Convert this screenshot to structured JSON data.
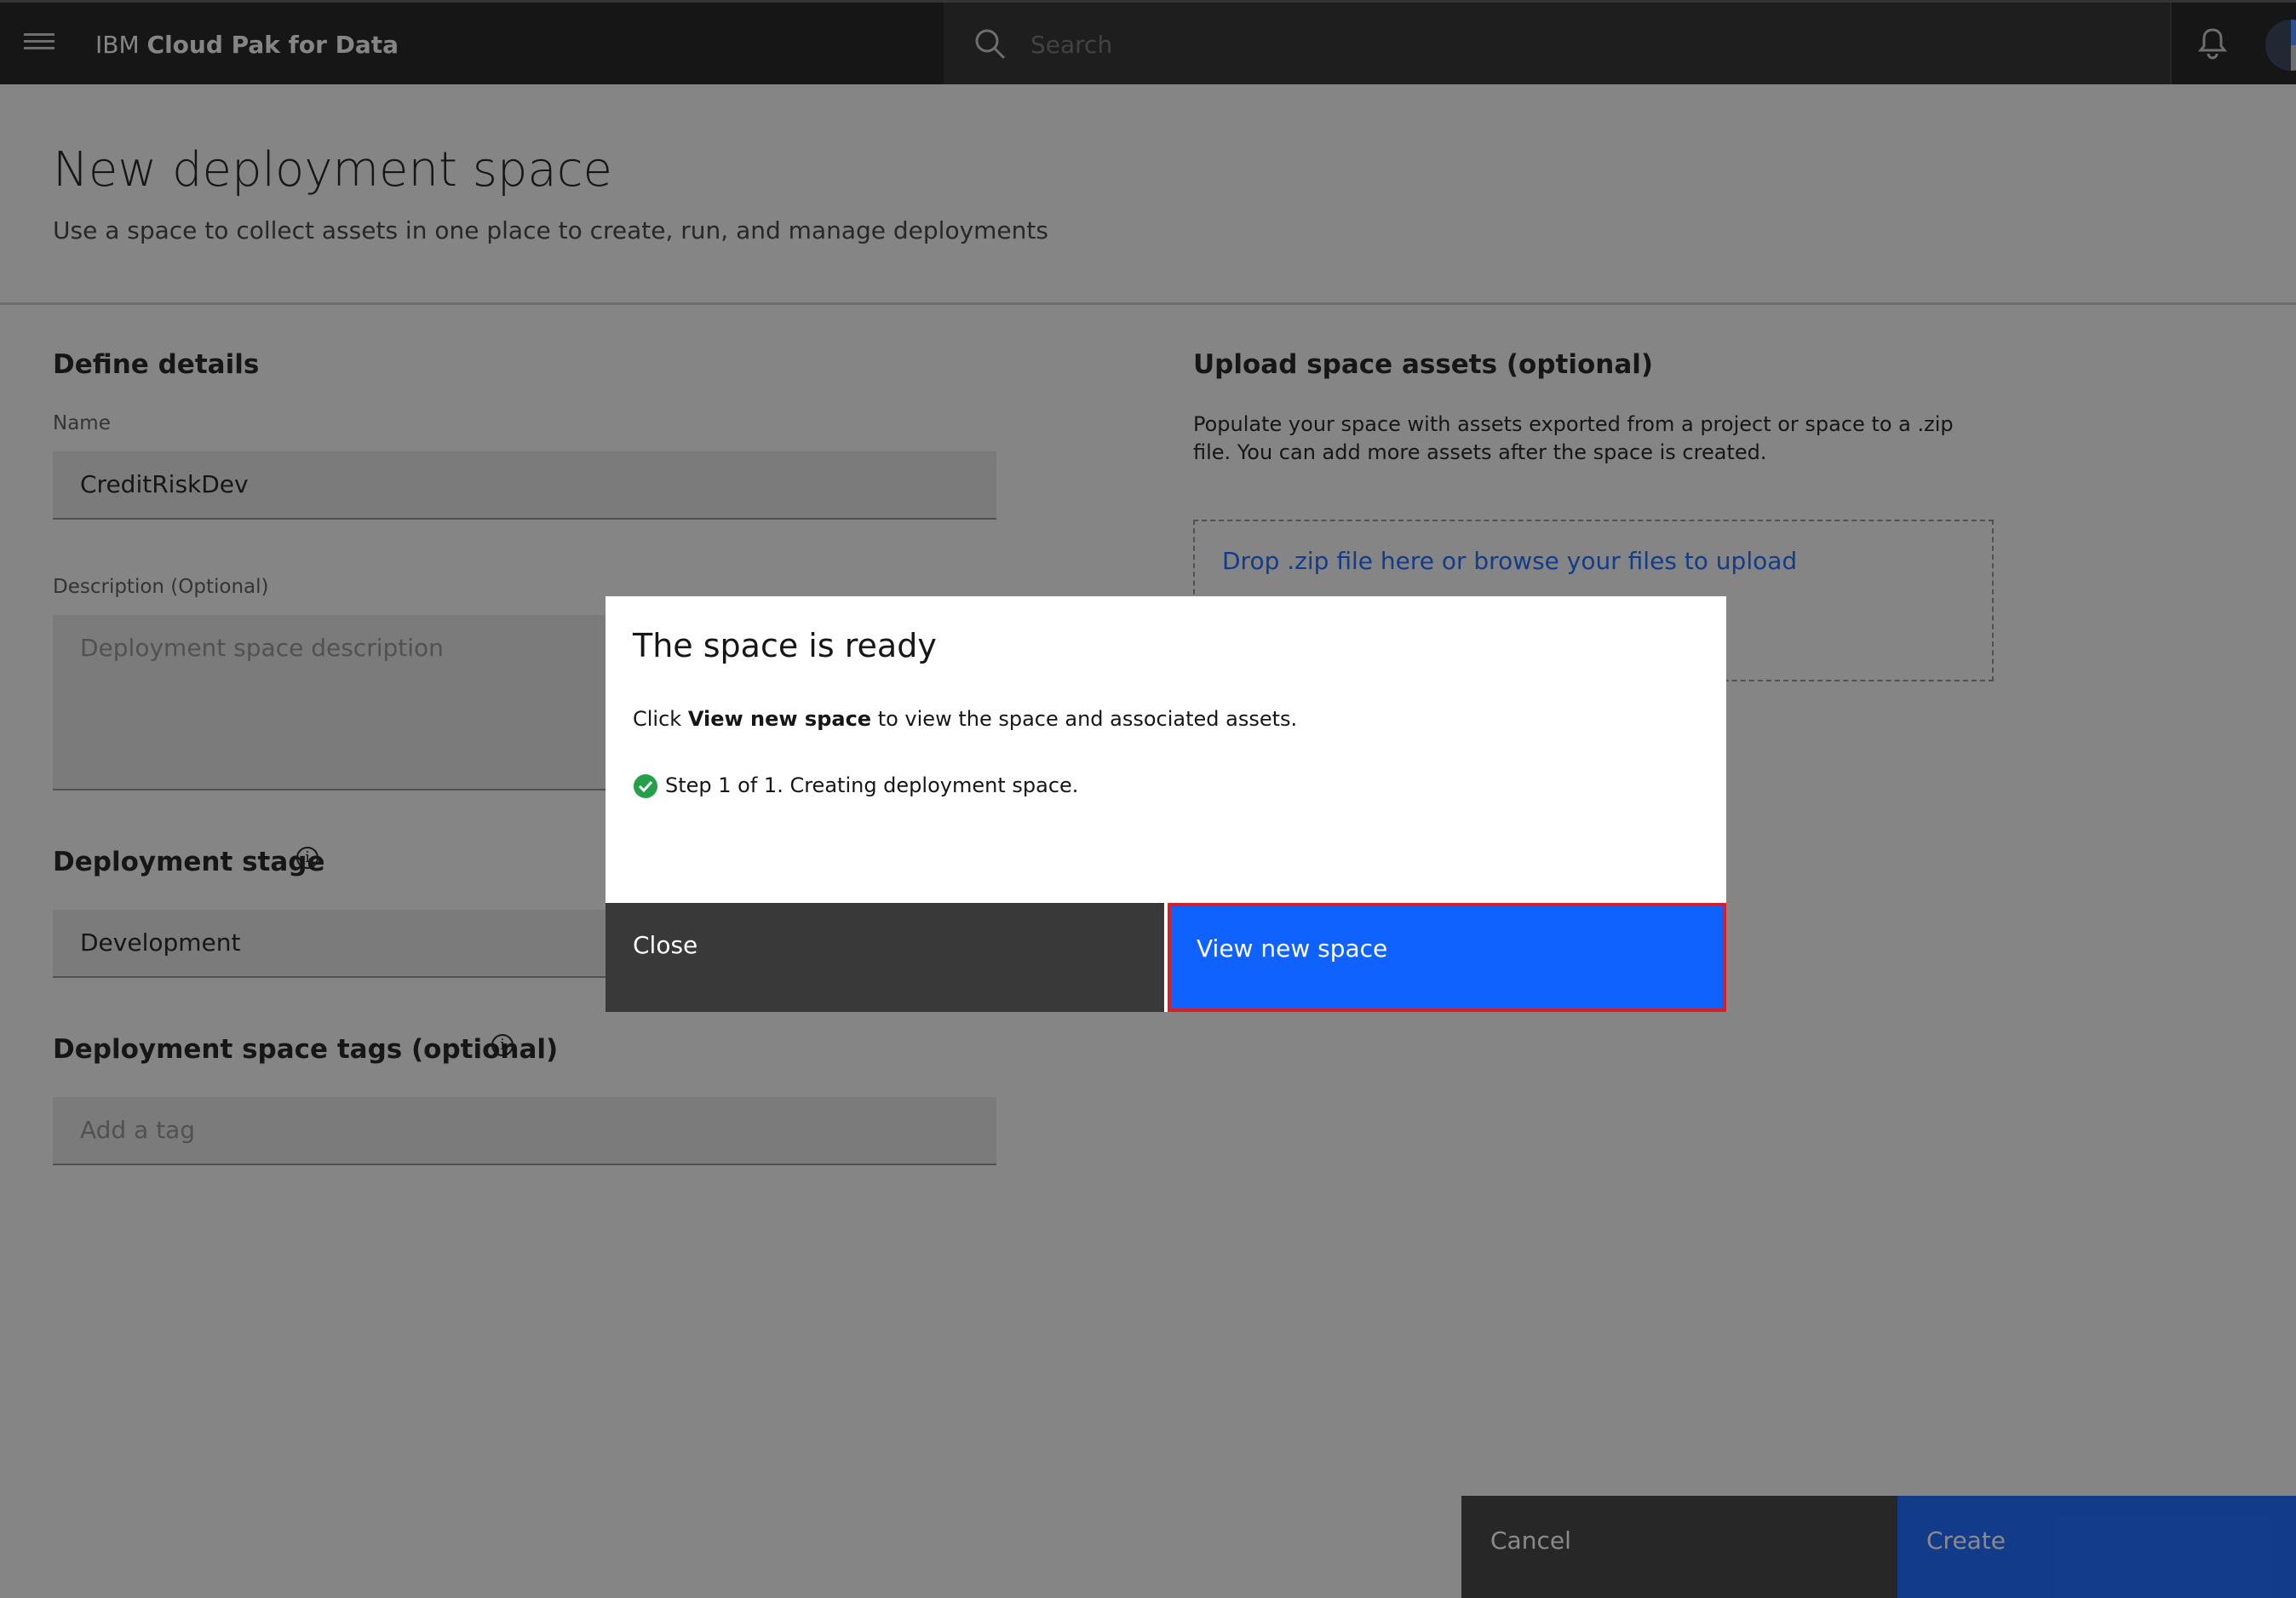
{
  "header": {
    "brand_prefix": "IBM",
    "brand_name": "Cloud Pak for Data",
    "search_placeholder": "Search"
  },
  "page": {
    "title": "New deployment space",
    "subtitle": "Use a space to collect assets in one place to create, run, and manage deployments"
  },
  "details": {
    "section_title": "Define details",
    "name_label": "Name",
    "name_value": "CreditRiskDev",
    "description_label": "Description (Optional)",
    "description_placeholder": "Deployment space description"
  },
  "stage": {
    "section_title": "Deployment stage",
    "value": "Development"
  },
  "tags": {
    "section_title": "Deployment space tags (optional)",
    "placeholder": "Add a tag"
  },
  "upload": {
    "section_title": "Upload space assets (optional)",
    "description": "Populate your space with assets exported from a project or space to a .zip file. You can add more assets after the space is created.",
    "dropzone_text": "Drop .zip file here or browse your files to upload"
  },
  "footer": {
    "cancel_label": "Cancel",
    "create_label": "Create"
  },
  "modal": {
    "title": "The space is ready",
    "body_prefix": "Click ",
    "body_bold": "View new space",
    "body_suffix": " to view the space and associated assets.",
    "step_text": "Step 1 of 1. Creating deployment space.",
    "close_label": "Close",
    "view_label": "View new space"
  },
  "colors": {
    "primary": "#0f62fe",
    "success": "#24a148",
    "highlight_border": "#da1e28"
  },
  "icons": [
    "menu-icon",
    "search-icon",
    "bell-icon",
    "avatar",
    "info-icon",
    "check-circle-icon"
  ]
}
